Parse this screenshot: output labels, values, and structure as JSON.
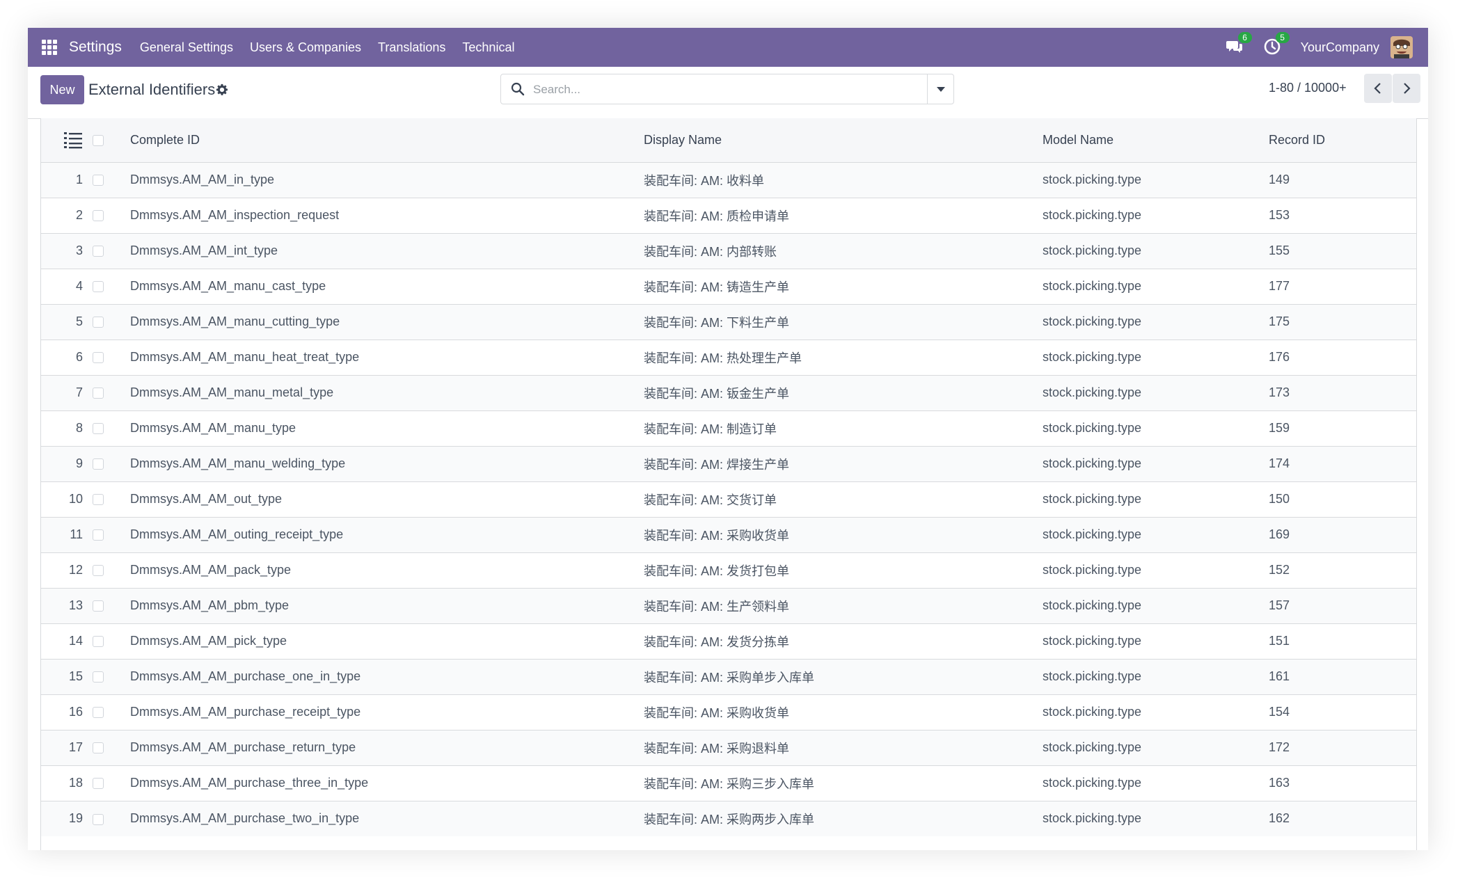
{
  "navbar": {
    "app_name": "Settings",
    "menu": [
      "General Settings",
      "Users & Companies",
      "Translations",
      "Technical"
    ],
    "messages_count": "6",
    "activities_count": "5",
    "company": "YourCompany",
    "background_color": "#71639e"
  },
  "control": {
    "new_label": "New",
    "title": "External Identifiers",
    "search_placeholder": "Search...",
    "pager": "1-80 / 10000+"
  },
  "table": {
    "columns": [
      "Complete ID",
      "Display Name",
      "Model Name",
      "Record ID"
    ],
    "rows": [
      {
        "num": "1",
        "complete_id": "Dmmsys.AM_AM_in_type",
        "display_name": "装配车间: AM: 收料单",
        "model": "stock.picking.type",
        "record_id": "149"
      },
      {
        "num": "2",
        "complete_id": "Dmmsys.AM_AM_inspection_request",
        "display_name": "装配车间: AM: 质检申请单",
        "model": "stock.picking.type",
        "record_id": "153"
      },
      {
        "num": "3",
        "complete_id": "Dmmsys.AM_AM_int_type",
        "display_name": "装配车间: AM: 内部转账",
        "model": "stock.picking.type",
        "record_id": "155"
      },
      {
        "num": "4",
        "complete_id": "Dmmsys.AM_AM_manu_cast_type",
        "display_name": "装配车间: AM: 铸造生产单",
        "model": "stock.picking.type",
        "record_id": "177"
      },
      {
        "num": "5",
        "complete_id": "Dmmsys.AM_AM_manu_cutting_type",
        "display_name": "装配车间: AM: 下料生产单",
        "model": "stock.picking.type",
        "record_id": "175"
      },
      {
        "num": "6",
        "complete_id": "Dmmsys.AM_AM_manu_heat_treat_type",
        "display_name": "装配车间: AM: 热处理生产单",
        "model": "stock.picking.type",
        "record_id": "176"
      },
      {
        "num": "7",
        "complete_id": "Dmmsys.AM_AM_manu_metal_type",
        "display_name": "装配车间: AM: 钣金生产单",
        "model": "stock.picking.type",
        "record_id": "173"
      },
      {
        "num": "8",
        "complete_id": "Dmmsys.AM_AM_manu_type",
        "display_name": "装配车间: AM: 制造订单",
        "model": "stock.picking.type",
        "record_id": "159"
      },
      {
        "num": "9",
        "complete_id": "Dmmsys.AM_AM_manu_welding_type",
        "display_name": "装配车间: AM: 焊接生产单",
        "model": "stock.picking.type",
        "record_id": "174"
      },
      {
        "num": "10",
        "complete_id": "Dmmsys.AM_AM_out_type",
        "display_name": "装配车间: AM: 交货订单",
        "model": "stock.picking.type",
        "record_id": "150"
      },
      {
        "num": "11",
        "complete_id": "Dmmsys.AM_AM_outing_receipt_type",
        "display_name": "装配车间: AM: 采购收货单",
        "model": "stock.picking.type",
        "record_id": "169"
      },
      {
        "num": "12",
        "complete_id": "Dmmsys.AM_AM_pack_type",
        "display_name": "装配车间: AM: 发货打包单",
        "model": "stock.picking.type",
        "record_id": "152"
      },
      {
        "num": "13",
        "complete_id": "Dmmsys.AM_AM_pbm_type",
        "display_name": "装配车间: AM: 生产领料单",
        "model": "stock.picking.type",
        "record_id": "157"
      },
      {
        "num": "14",
        "complete_id": "Dmmsys.AM_AM_pick_type",
        "display_name": "装配车间: AM: 发货分拣单",
        "model": "stock.picking.type",
        "record_id": "151"
      },
      {
        "num": "15",
        "complete_id": "Dmmsys.AM_AM_purchase_one_in_type",
        "display_name": "装配车间: AM: 采购单步入库单",
        "model": "stock.picking.type",
        "record_id": "161"
      },
      {
        "num": "16",
        "complete_id": "Dmmsys.AM_AM_purchase_receipt_type",
        "display_name": "装配车间: AM: 采购收货单",
        "model": "stock.picking.type",
        "record_id": "154"
      },
      {
        "num": "17",
        "complete_id": "Dmmsys.AM_AM_purchase_return_type",
        "display_name": "装配车间: AM: 采购退料单",
        "model": "stock.picking.type",
        "record_id": "172"
      },
      {
        "num": "18",
        "complete_id": "Dmmsys.AM_AM_purchase_three_in_type",
        "display_name": "装配车间: AM: 采购三步入库单",
        "model": "stock.picking.type",
        "record_id": "163"
      },
      {
        "num": "19",
        "complete_id": "Dmmsys.AM_AM_purchase_two_in_type",
        "display_name": "装配车间: AM: 采购两步入库单",
        "model": "stock.picking.type",
        "record_id": "162"
      }
    ]
  }
}
